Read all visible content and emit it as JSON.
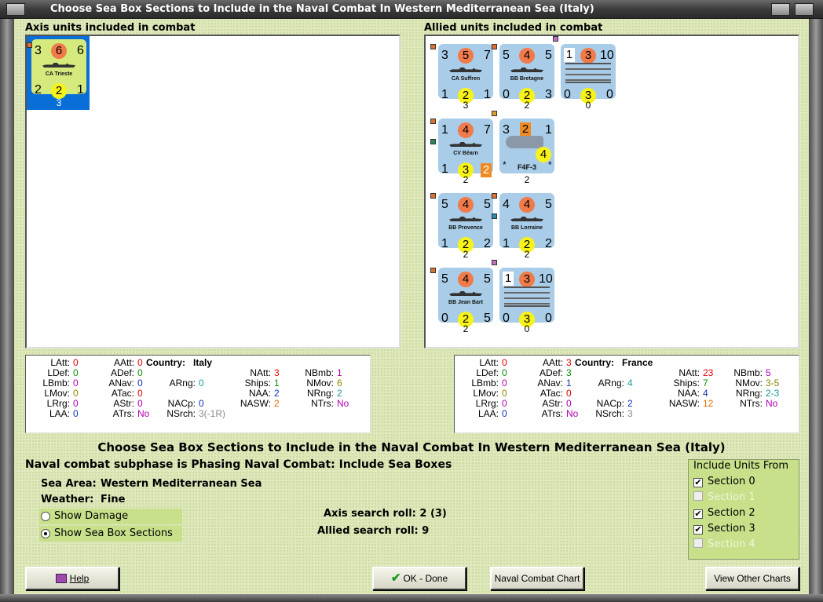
{
  "window": {
    "title": "Choose Sea Box Sections to Include in the Naval Combat In Western Mediterranean Sea (Italy)"
  },
  "axis_panel": {
    "header": "Axis units included in combat",
    "units": [
      {
        "name": "CA Trieste",
        "tl": "3",
        "tc": "6",
        "tr": "6",
        "bl": "2",
        "bc": "2",
        "br": "1",
        "count": "3"
      }
    ]
  },
  "allied_panel": {
    "header": "Allied units included in combat",
    "units": [
      {
        "name": "CA Suffren",
        "tl": "3",
        "tc": "5",
        "tr": "7",
        "bl": "1",
        "bc": "2",
        "br": "1",
        "count": "3"
      },
      {
        "name": "BB Bretagne",
        "tl": "5",
        "tc": "4",
        "tr": "5",
        "bl": "0",
        "bc": "2",
        "br": "3",
        "count": "2"
      },
      {
        "name": "",
        "tl": "1",
        "tc": "3",
        "tr": "10",
        "bl": "0",
        "bc": "3",
        "br": "0",
        "count": "0"
      },
      {
        "name": "CV Béarn",
        "tl": "1",
        "tc": "4",
        "tr": "7",
        "bl": "1",
        "bc": "3",
        "br": "2",
        "count": "2"
      },
      {
        "name": "F4F-3",
        "tl": "3",
        "tc": "2",
        "tr": "1",
        "mid": "4",
        "bl": "*",
        "br": "*",
        "count": "2"
      },
      {
        "name": "BB Provence",
        "tl": "5",
        "tc": "4",
        "tr": "5",
        "bl": "1",
        "bc": "2",
        "br": "2",
        "count": "2"
      },
      {
        "name": "BB Lorraine",
        "tl": "4",
        "tc": "4",
        "tr": "5",
        "bl": "1",
        "bc": "2",
        "br": "2",
        "count": "2"
      },
      {
        "name": "BB Jean Bart",
        "tl": "5",
        "tc": "4",
        "tr": "5",
        "bl": "0",
        "bc": "2",
        "br": "5",
        "count": "2"
      },
      {
        "name": "",
        "tl": "1",
        "tc": "3",
        "tr": "10",
        "bl": "0",
        "bc": "3",
        "br": "0",
        "count": "0"
      }
    ]
  },
  "axis_stats": {
    "country_label": "Country:",
    "country": "Italy",
    "LAtt": "0",
    "LDef": "0",
    "LBmb": "0",
    "LMov": "0",
    "LRrg": "0",
    "LAA": "0",
    "AAtt": "0",
    "ADef": "0",
    "ANav": "0",
    "ATac": "0",
    "AStr": "0",
    "ATrs": "No",
    "ARng": "0",
    "NACp": "0",
    "NSrch": "3(-1R)",
    "NAtt": "3",
    "Ships": "1",
    "NAA": "2",
    "NASW": "2",
    "NBmb": "1",
    "NMov": "6",
    "NRng": "2",
    "NTrs": "No"
  },
  "allied_stats": {
    "country_label": "Country:",
    "country": "France",
    "LAtt": "0",
    "LDef": "0",
    "LBmb": "0",
    "LMov": "0",
    "LRrg": "0",
    "LAA": "0",
    "AAtt": "3",
    "ADef": "3",
    "ANav": "1",
    "ATac": "0",
    "AStr": "0",
    "ATrs": "No",
    "ARng": "4",
    "NACp": "2",
    "NSrch": "3",
    "NAtt": "23",
    "Ships": "7",
    "NAA": "4",
    "NASW": "12",
    "NBmb": "5",
    "NMov": "3-5",
    "NRng": "2-3",
    "NTrs": "No"
  },
  "main": {
    "heading": "Choose Sea Box Sections to Include in the Naval Combat In Western Mediterranean Sea (Italy)",
    "subphase": "Naval combat subphase is Phasing Naval Combat: Include Sea Boxes",
    "sea_area_label": "Sea Area:",
    "sea_area": "Western Mediterranean Sea",
    "weather_label": "Weather:",
    "weather": "Fine",
    "show_damage": "Show Damage",
    "show_sections": "Show Sea Box Sections",
    "axis_roll": "Axis search roll: 2 (3)",
    "allied_roll": "Allied search roll: 9"
  },
  "include": {
    "title": "Include Units From",
    "sections": [
      {
        "label": "Section 0",
        "checked": true,
        "enabled": true
      },
      {
        "label": "Section 1",
        "checked": false,
        "enabled": false
      },
      {
        "label": "Section 2",
        "checked": true,
        "enabled": true
      },
      {
        "label": "Section 3",
        "checked": true,
        "enabled": true
      },
      {
        "label": "Section 4",
        "checked": false,
        "enabled": false
      }
    ]
  },
  "buttons": {
    "help": "Help",
    "ok": "OK - Done",
    "naval_chart": "Naval Combat Chart",
    "other_charts": "View Other Charts"
  }
}
